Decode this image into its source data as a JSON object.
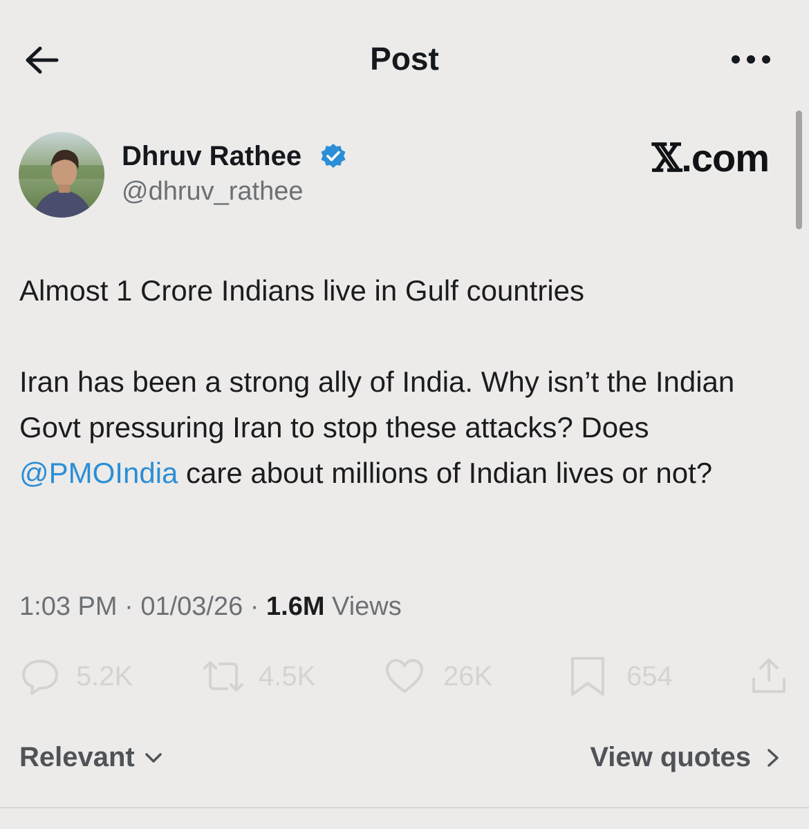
{
  "header": {
    "title": "Post",
    "back_icon": "arrow-left-icon",
    "more_icon": "more-horizontal-icon"
  },
  "author": {
    "name": "Dhruv Rathee",
    "handle": "@dhruv_rathee",
    "verified": true,
    "verified_color": "#2b8ed6"
  },
  "brand": {
    "logo_x": "𝕏",
    "logo_suffix": ".com"
  },
  "post": {
    "line1": "Almost 1 Crore Indians live in Gulf countries",
    "line2_part1": "Iran has been a strong ally of India. Why isn’t the Indian Govt pressuring Iran to stop these attacks? Does ",
    "mention": "@PMOIndia",
    "line2_part2": " care about millions of Indian lives or not?"
  },
  "meta": {
    "time": "1:03 PM",
    "sep1": " · ",
    "date": "01/03/26",
    "sep2": " · ",
    "views_count": "1.6M",
    "views_label": " Views"
  },
  "actions": {
    "replies": "5.2K",
    "reposts": "4.5K",
    "likes": "26K",
    "bookmarks": "654"
  },
  "footer": {
    "sort_label": "Relevant",
    "quotes_label": "View quotes"
  },
  "colors": {
    "background": "#ecebe9",
    "mention": "#2b8ed6",
    "muted_text": "#6c7075",
    "faded_action": "#d4d3d1"
  }
}
